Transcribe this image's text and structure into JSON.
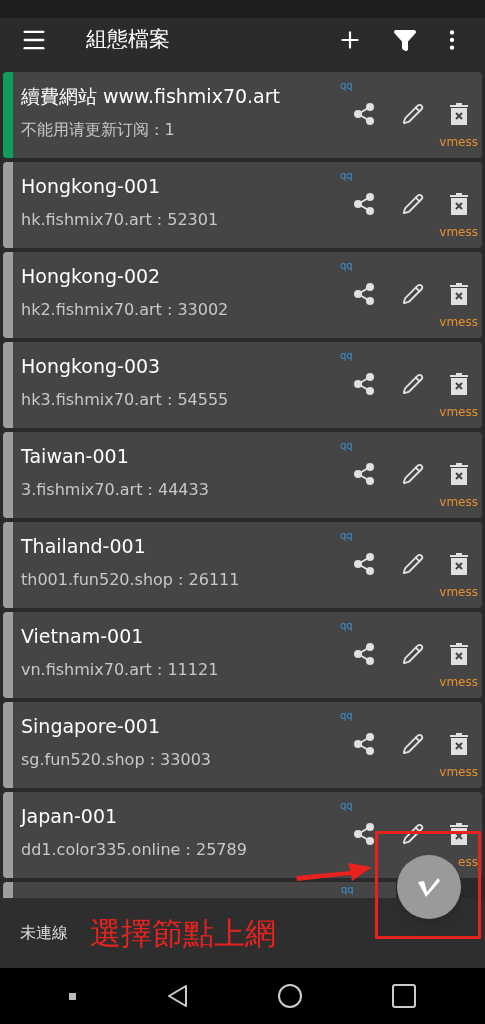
{
  "toolbar": {
    "title": "組態檔案"
  },
  "servers": [
    {
      "name": "續費網站 www.fishmix70.art",
      "address": "不能用请更新订阅 : 1",
      "tag": "qq",
      "protocol": "vmess",
      "selected": true
    },
    {
      "name": "Hongkong-001",
      "address": "hk.fishmix70.art : 52301",
      "tag": "qq",
      "protocol": "vmess",
      "selected": false
    },
    {
      "name": "Hongkong-002",
      "address": "hk2.fishmix70.art : 33002",
      "tag": "qq",
      "protocol": "vmess",
      "selected": false
    },
    {
      "name": "Hongkong-003",
      "address": "hk3.fishmix70.art : 54555",
      "tag": "qq",
      "protocol": "vmess",
      "selected": false
    },
    {
      "name": "Taiwan-001",
      "address": "3.fishmix70.art : 44433",
      "tag": "qq",
      "protocol": "vmess",
      "selected": false
    },
    {
      "name": "Thailand-001",
      "address": "th001.fun520.shop : 26111",
      "tag": "qq",
      "protocol": "vmess",
      "selected": false
    },
    {
      "name": "Vietnam-001",
      "address": "vn.fishmix70.art : 11121",
      "tag": "qq",
      "protocol": "vmess",
      "selected": false
    },
    {
      "name": "Singapore-001",
      "address": "sg.fun520.shop : 33003",
      "tag": "qq",
      "protocol": "vmess",
      "selected": false
    },
    {
      "name": "Japan-001",
      "address": "dd1.color335.online : 25789",
      "tag": "qq",
      "protocol": "ess",
      "selected": false
    }
  ],
  "cut_server": {
    "tag": "qq",
    "selected": false
  },
  "status_bar": {
    "text": "未連線"
  },
  "annotation": {
    "text": "選擇節點上網"
  }
}
